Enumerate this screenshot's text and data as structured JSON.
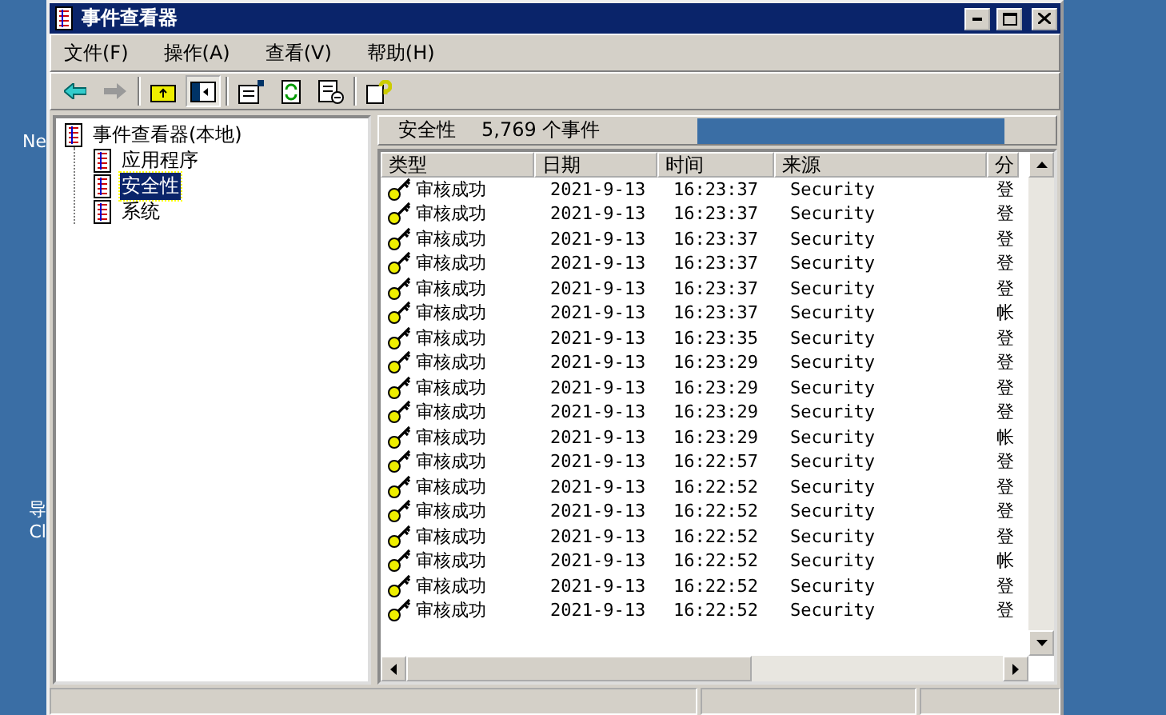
{
  "desktop_labels": [
    "Ne",
    "导",
    "Cl"
  ],
  "window": {
    "title": "事件查看器"
  },
  "menu": [
    "文件(F)",
    "操作(A)",
    "查看(V)",
    "帮助(H)"
  ],
  "tree": [
    {
      "label": "事件查看器(本地)",
      "selected": false,
      "expanded": true,
      "children": [
        {
          "label": "应用程序",
          "selected": false
        },
        {
          "label": "安全性",
          "selected": true
        },
        {
          "label": "系统",
          "selected": false
        }
      ]
    }
  ],
  "pane_header": {
    "title": "安全性",
    "count": "5,769 个事件"
  },
  "table": {
    "columns": [
      "类型",
      "日期",
      "时间",
      "来源",
      "分"
    ],
    "rows": [
      [
        "审核成功",
        "2021-9-13",
        "16:23:37",
        "Security",
        "登"
      ],
      [
        "审核成功",
        "2021-9-13",
        "16:23:37",
        "Security",
        "登"
      ],
      [
        "审核成功",
        "2021-9-13",
        "16:23:37",
        "Security",
        "登"
      ],
      [
        "审核成功",
        "2021-9-13",
        "16:23:37",
        "Security",
        "登"
      ],
      [
        "审核成功",
        "2021-9-13",
        "16:23:37",
        "Security",
        "登"
      ],
      [
        "审核成功",
        "2021-9-13",
        "16:23:37",
        "Security",
        "帐"
      ],
      [
        "审核成功",
        "2021-9-13",
        "16:23:35",
        "Security",
        "登"
      ],
      [
        "审核成功",
        "2021-9-13",
        "16:23:29",
        "Security",
        "登"
      ],
      [
        "审核成功",
        "2021-9-13",
        "16:23:29",
        "Security",
        "登"
      ],
      [
        "审核成功",
        "2021-9-13",
        "16:23:29",
        "Security",
        "登"
      ],
      [
        "审核成功",
        "2021-9-13",
        "16:23:29",
        "Security",
        "帐"
      ],
      [
        "审核成功",
        "2021-9-13",
        "16:22:57",
        "Security",
        "登"
      ],
      [
        "审核成功",
        "2021-9-13",
        "16:22:52",
        "Security",
        "登"
      ],
      [
        "审核成功",
        "2021-9-13",
        "16:22:52",
        "Security",
        "登"
      ],
      [
        "审核成功",
        "2021-9-13",
        "16:22:52",
        "Security",
        "登"
      ],
      [
        "审核成功",
        "2021-9-13",
        "16:22:52",
        "Security",
        "帐"
      ],
      [
        "审核成功",
        "2021-9-13",
        "16:22:52",
        "Security",
        "登"
      ],
      [
        "审核成功",
        "2021-9-13",
        "16:22:52",
        "Security",
        "登"
      ]
    ]
  }
}
